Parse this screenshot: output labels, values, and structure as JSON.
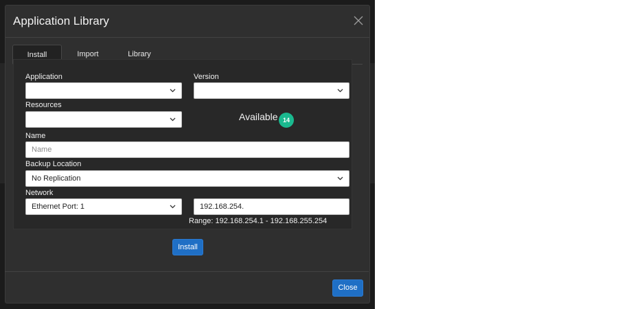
{
  "modal": {
    "title": "Application Library"
  },
  "tabs": [
    {
      "label": "Install",
      "active": true
    },
    {
      "label": "Import",
      "active": false
    },
    {
      "label": "Library",
      "active": false
    }
  ],
  "form": {
    "application": {
      "label": "Application",
      "value": ""
    },
    "version": {
      "label": "Version",
      "value": ""
    },
    "resources": {
      "label": "Resources",
      "value": ""
    },
    "available": {
      "label": "Available",
      "count": "14"
    },
    "name": {
      "label": "Name",
      "value": "",
      "placeholder": "Name"
    },
    "backup": {
      "label": "Backup Location",
      "value": "No Replication"
    },
    "network": {
      "label": "Network",
      "port_value": "Ethernet Port: 1",
      "ip_value": "192.168.254.",
      "range_text": "Range: 192.168.254.1 - 192.168.255.254"
    }
  },
  "buttons": {
    "install": "Install",
    "close": "Close"
  },
  "colors": {
    "accent": "#1f6fc5",
    "badge": "#1ab98f",
    "modal_bg": "#2f2f2f"
  },
  "icons": {
    "close": "close-icon",
    "dropdown": "chevron-down-icon"
  }
}
